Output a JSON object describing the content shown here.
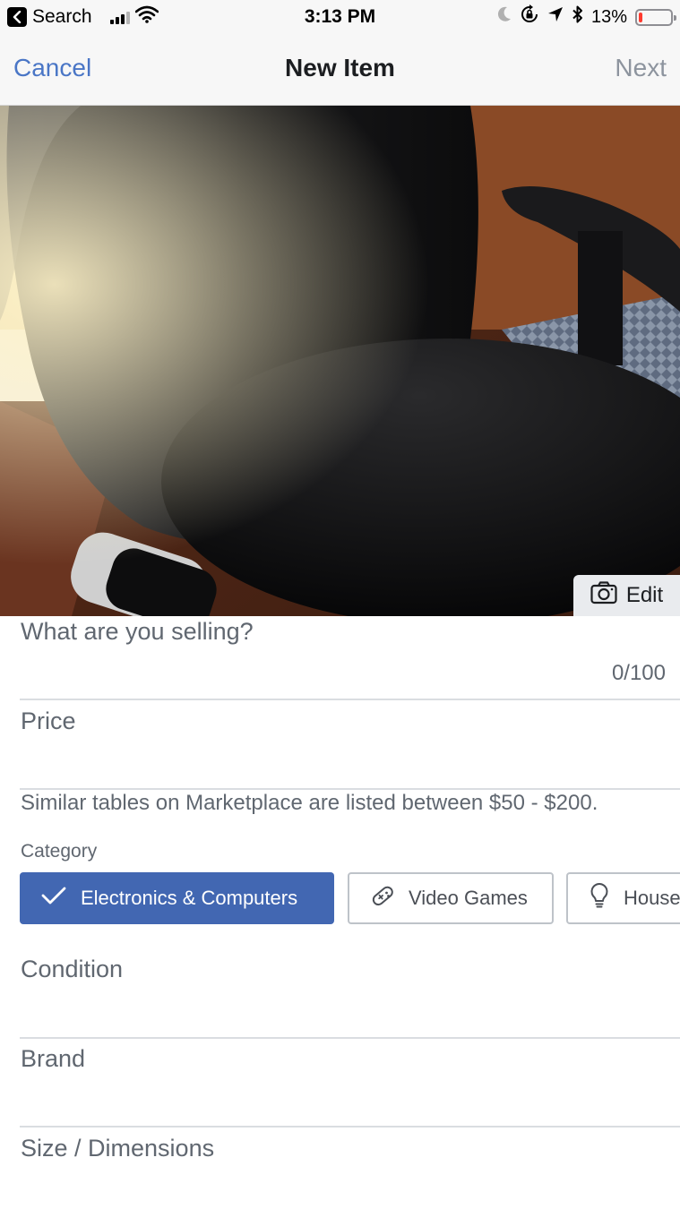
{
  "status_bar": {
    "back_app": "Search",
    "time": "3:13 PM",
    "battery_percent": "13%",
    "battery_level": 0.13,
    "battery_color": "#ff3b30"
  },
  "nav": {
    "cancel": "Cancel",
    "title": "New Item",
    "next": "Next"
  },
  "photo": {
    "edit_label": "Edit",
    "edit_icon": "camera-icon"
  },
  "form": {
    "title_placeholder": "What are you selling?",
    "char_count": "0/100",
    "price_label": "Price",
    "price_hint": "Similar tables on Marketplace are listed between $50 - $200.",
    "category_label": "Category",
    "categories": [
      {
        "label": "Electronics & Computers",
        "icon": "checkmark-icon",
        "selected": true
      },
      {
        "label": "Video Games",
        "icon": "game-controller-icon",
        "selected": false
      },
      {
        "label": "Household",
        "icon": "lightbulb-icon",
        "selected": false
      }
    ],
    "condition_label": "Condition",
    "brand_label": "Brand",
    "size_label": "Size / Dimensions"
  },
  "colors": {
    "accent": "#4267b2",
    "link": "#4a76c6",
    "disabled": "#8d949e"
  }
}
